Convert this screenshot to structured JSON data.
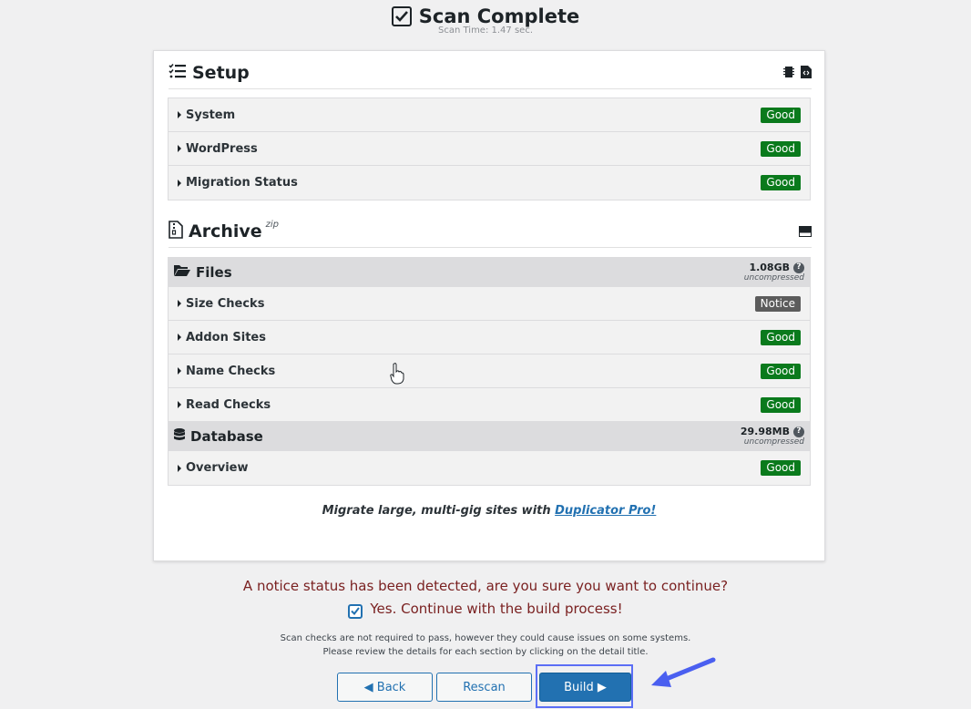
{
  "header": {
    "title": "Scan Complete",
    "scan_time": "Scan Time: 1.47 sec."
  },
  "setup": {
    "title": "Setup",
    "items": [
      {
        "label": "System",
        "status": "Good"
      },
      {
        "label": "WordPress",
        "status": "Good"
      },
      {
        "label": "Migration Status",
        "status": "Good"
      }
    ]
  },
  "archive": {
    "title": "Archive",
    "format": "zip",
    "files": {
      "title": "Files",
      "size": "1.08GB",
      "size_note": "uncompressed"
    },
    "file_checks": [
      {
        "label": "Size Checks",
        "status": "Notice"
      },
      {
        "label": "Addon Sites",
        "status": "Good"
      },
      {
        "label": "Name Checks",
        "status": "Good"
      },
      {
        "label": "Read Checks",
        "status": "Good"
      }
    ],
    "database": {
      "title": "Database",
      "size": "29.98MB",
      "size_note": "uncompressed"
    },
    "db_checks": [
      {
        "label": "Overview",
        "status": "Good"
      }
    ]
  },
  "promo": {
    "text": "Migrate large, multi-gig sites with ",
    "link": "Duplicator Pro!"
  },
  "notice": {
    "question": "A notice status has been detected, are you sure you want to continue?",
    "confirm_label": "Yes. Continue with the build process!",
    "confirm_checked": true,
    "fine_1": "Scan checks are not required to pass, however they could cause issues on some systems.",
    "fine_2": "Please review the details for each section by clicking on the detail title."
  },
  "buttons": {
    "back": "◀ Back",
    "rescan": "Rescan",
    "build": "Build ▶"
  },
  "colors": {
    "good": "#0a7a1c",
    "notice": "#5c5c5c",
    "primary": "#2271b1",
    "warning_text": "#7a2121"
  }
}
